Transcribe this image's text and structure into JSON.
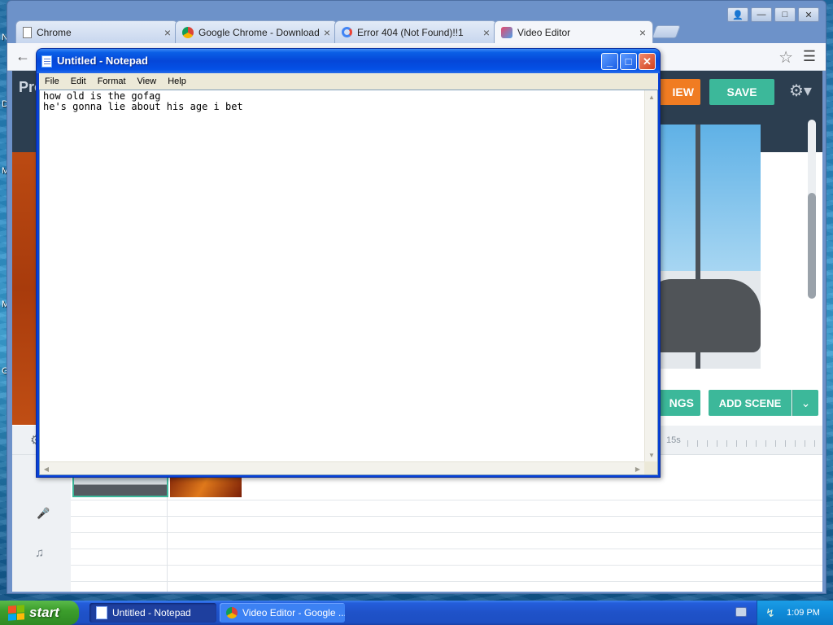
{
  "desktop": {
    "edge_letters": [
      "N",
      "D",
      "M",
      "M",
      "G"
    ]
  },
  "chrome": {
    "tabs": [
      {
        "title": "Chrome",
        "icon": "page-icon"
      },
      {
        "title": "Google Chrome - Download t",
        "icon": "chrome-icon"
      },
      {
        "title": "Error 404 (Not Found)!!1",
        "icon": "google-icon"
      },
      {
        "title": "Video Editor",
        "icon": "video-editor-icon"
      }
    ],
    "close_glyph": "×",
    "window_controls": [
      "user-icon",
      "minimize-icon",
      "maximize-icon",
      "close-icon"
    ]
  },
  "video_editor": {
    "project_title_partial": "Pro",
    "preview_partial": "IEW",
    "save_label": "SAVE",
    "settings_partial": "NGS",
    "add_scene_label": "ADD SCENE",
    "timeline_time": "15s",
    "accent_color": "#3cb89a",
    "preview_color": "#f07c22"
  },
  "notepad": {
    "title": "Untitled - Notepad",
    "menu": [
      "File",
      "Edit",
      "Format",
      "View",
      "Help"
    ],
    "text": "how old is the gofag\nhe's gonna lie about his age i bet"
  },
  "taskbar": {
    "start_label": "start",
    "tasks": [
      {
        "label": "Untitled - Notepad",
        "active": true
      },
      {
        "label": "Video Editor - Google ...",
        "active": false
      }
    ],
    "clock": "1:09 PM"
  }
}
